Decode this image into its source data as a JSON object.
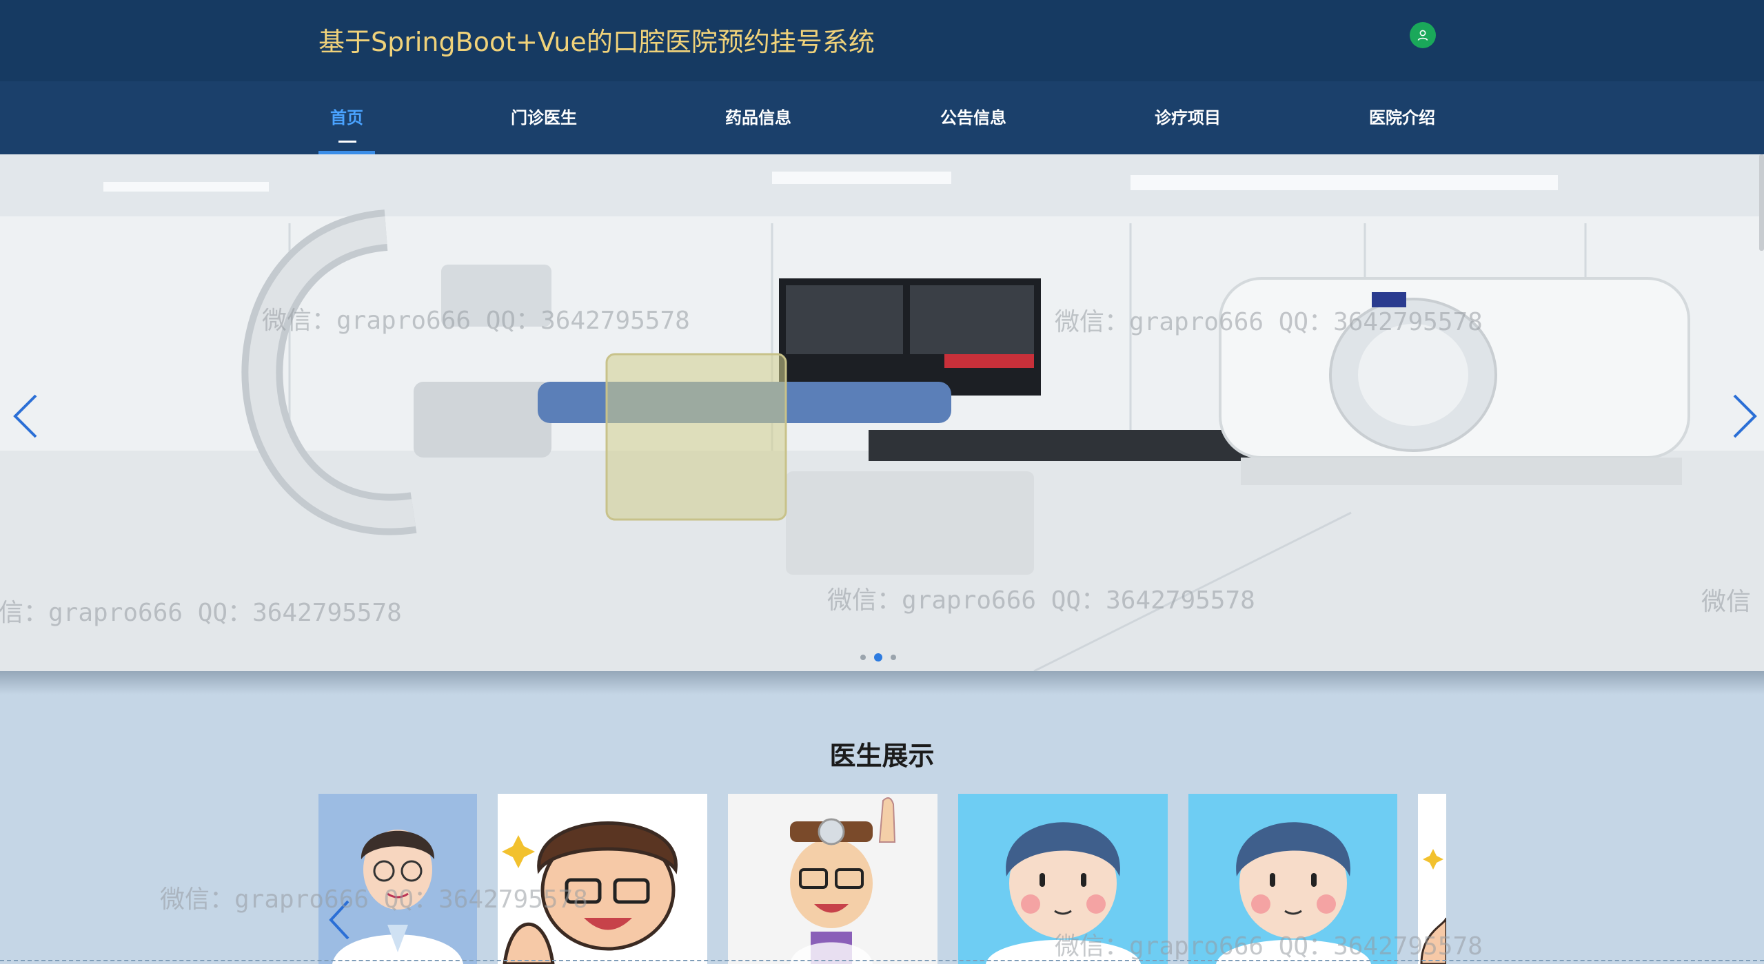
{
  "header": {
    "title": "基于SpringBoot+Vue的口腔医院预约挂号系统"
  },
  "nav": {
    "items": [
      {
        "label": "首页",
        "active": true
      },
      {
        "label": "门诊医生",
        "active": false
      },
      {
        "label": "药品信息",
        "active": false
      },
      {
        "label": "公告信息",
        "active": false
      },
      {
        "label": "诊疗项目",
        "active": false
      },
      {
        "label": "医院介绍",
        "active": false
      }
    ]
  },
  "banner": {
    "watermarks": [
      "微信：grapro666 QQ：3642795578",
      "微信：grapro666 QQ：3642795578",
      "信：grapro666 QQ：3642795578",
      "微信：grapro666 QQ：3642795578",
      "微信"
    ],
    "dots": [
      false,
      true,
      false
    ]
  },
  "doctors_section": {
    "title": "医生展示",
    "watermarks": [
      "微信：grapro666 QQ：3642795578",
      "微信：grapro666 QQ：3642795578"
    ]
  },
  "colors": {
    "header_bg": "#163a62",
    "nav_bg": "#1b406b",
    "title_gold": "#f0d27a",
    "active_blue": "#4aa3ff",
    "page_bg": "#c5d6e6",
    "avatar_green": "#1aa85a"
  },
  "icons": [
    "user-icon",
    "chevron-left-icon",
    "chevron-right-icon"
  ]
}
